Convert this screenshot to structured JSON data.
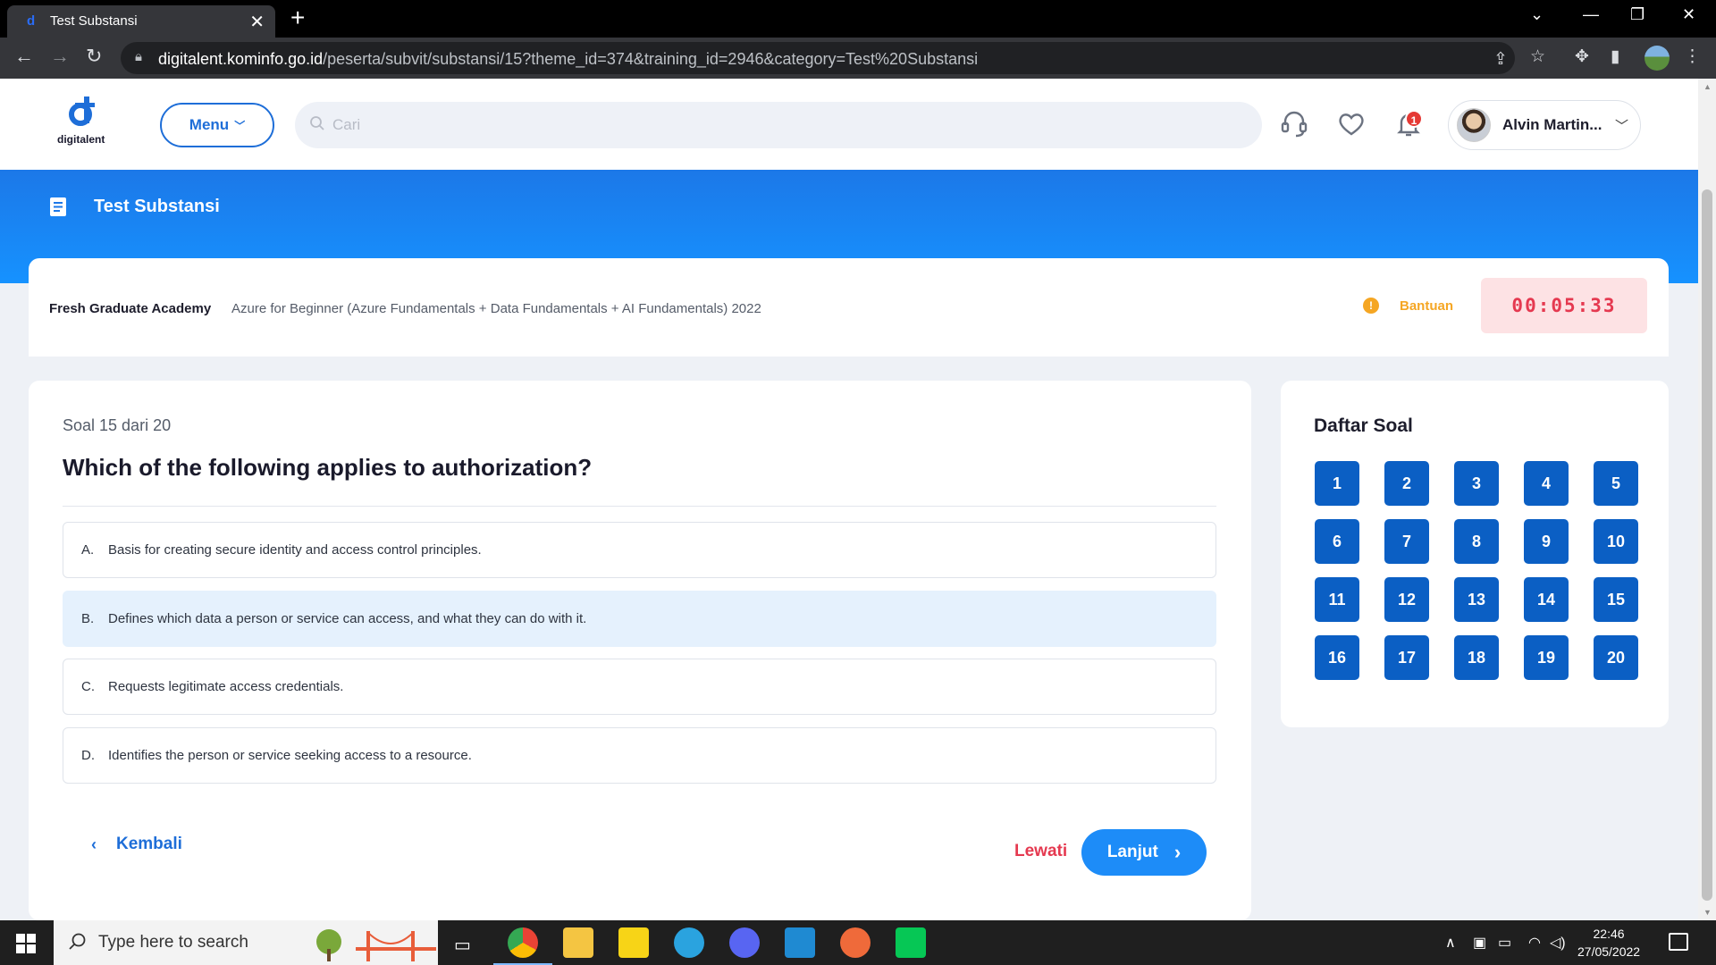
{
  "browser": {
    "tab_title": "Test Substansi",
    "url_host": "digitalent.kominfo.go.id",
    "url_path": "/peserta/subvit/substansi/15?theme_id=374&training_id=2946&category=Test%20Substansi"
  },
  "header": {
    "logo_text": "digitalent",
    "menu_label": "Menu",
    "search_placeholder": "Cari",
    "notification_count": "1",
    "user_name": "Alvin Martin..."
  },
  "banner": {
    "title": "Test Substansi"
  },
  "info": {
    "academy": "Fresh Graduate Academy",
    "training": "Azure for Beginner (Azure Fundamentals + Data Fundamentals + AI Fundamentals) 2022",
    "help_label": "Bantuan",
    "timer": "00:05:33"
  },
  "question": {
    "counter": "Soal 15 dari 20",
    "text": "Which of the following applies to authorization?",
    "options": [
      {
        "letter": "A.",
        "text": "Basis for creating secure identity and access control principles."
      },
      {
        "letter": "B.",
        "text": "Defines which data a person or service can access, and what they can do with it."
      },
      {
        "letter": "C.",
        "text": "Requests legitimate access credentials."
      },
      {
        "letter": "D.",
        "text": "Identifies the person or service seeking access to a resource."
      }
    ],
    "selected_option": "B",
    "back_label": "Kembali",
    "skip_label": "Lewati",
    "next_label": "Lanjut"
  },
  "question_list": {
    "title": "Daftar Soal",
    "numbers": [
      "1",
      "2",
      "3",
      "4",
      "5",
      "6",
      "7",
      "8",
      "9",
      "10",
      "11",
      "12",
      "13",
      "14",
      "15",
      "16",
      "17",
      "18",
      "19",
      "20"
    ]
  },
  "taskbar": {
    "search_placeholder": "Type here to search",
    "time": "22:46",
    "date": "27/05/2022"
  },
  "colors": {
    "primary": "#1e6ed8",
    "banner": "#1c78e8",
    "question_tile": "#0b5fc4",
    "timer_text": "#e53950",
    "timer_bg": "#fde2e4",
    "help": "#f5a623",
    "selected_option_bg": "#e5f1fd"
  }
}
